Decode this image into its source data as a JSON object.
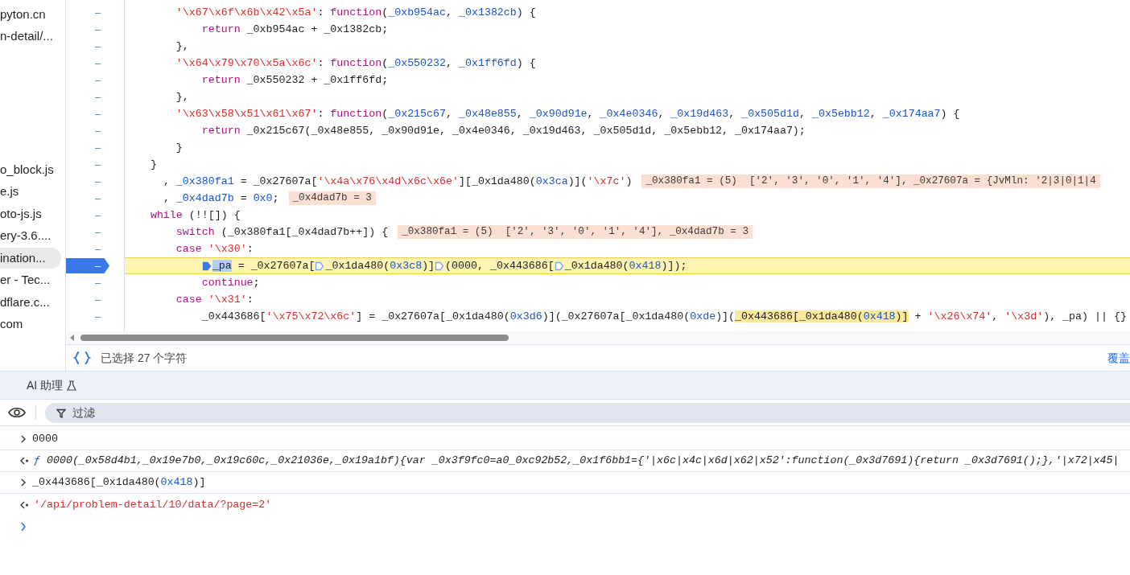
{
  "sidebar": {
    "upper_items": [
      {
        "label": "pyton.cn",
        "selected": false
      },
      {
        "label": "n-detail/...",
        "selected": false
      }
    ],
    "lower_items": [
      {
        "label": "o_block.js",
        "selected": false
      },
      {
        "label": "e.js",
        "selected": false
      },
      {
        "label": "oto-js.js",
        "selected": false
      },
      {
        "label": "ery-3.6....",
        "selected": false
      },
      {
        "label": "ination...",
        "selected": true
      },
      {
        "label": "er - Tec...",
        "selected": false
      },
      {
        "label": "dflare.c...",
        "selected": false
      },
      {
        "label": "com",
        "selected": false
      }
    ]
  },
  "code": {
    "lines": [
      {
        "gutter": "–",
        "paused": false,
        "segments": [
          {
            "kind": "indent8"
          },
          {
            "kind": "str",
            "text": "'\\x67\\x6f\\x6b\\x42\\x5a'"
          },
          {
            "kind": "plain",
            "text": ": "
          },
          {
            "kind": "kw",
            "text": "function"
          },
          {
            "kind": "plain",
            "text": "("
          },
          {
            "kind": "def",
            "text": "_0xb954ac"
          },
          {
            "kind": "plain",
            "text": ", "
          },
          {
            "kind": "def",
            "text": "_0x1382cb"
          },
          {
            "kind": "plain",
            "text": ") {"
          }
        ]
      },
      {
        "gutter": "–",
        "paused": false,
        "segments": [
          {
            "kind": "indent12"
          },
          {
            "kind": "kw",
            "text": "return"
          },
          {
            "kind": "plain",
            "text": " _0xb954ac + _0x1382cb;"
          }
        ]
      },
      {
        "gutter": "–",
        "paused": false,
        "segments": [
          {
            "kind": "indent8"
          },
          {
            "kind": "plain",
            "text": "},"
          }
        ]
      },
      {
        "gutter": "–",
        "paused": false,
        "segments": [
          {
            "kind": "indent8"
          },
          {
            "kind": "str",
            "text": "'\\x64\\x79\\x70\\x5a\\x6c'"
          },
          {
            "kind": "plain",
            "text": ": "
          },
          {
            "kind": "kw",
            "text": "function"
          },
          {
            "kind": "plain",
            "text": "("
          },
          {
            "kind": "def",
            "text": "_0x550232"
          },
          {
            "kind": "plain",
            "text": ", "
          },
          {
            "kind": "def",
            "text": "_0x1ff6fd"
          },
          {
            "kind": "plain",
            "text": ") {"
          }
        ]
      },
      {
        "gutter": "–",
        "paused": false,
        "segments": [
          {
            "kind": "indent12"
          },
          {
            "kind": "kw",
            "text": "return"
          },
          {
            "kind": "plain",
            "text": " _0x550232 + _0x1ff6fd;"
          }
        ]
      },
      {
        "gutter": "–",
        "paused": false,
        "segments": [
          {
            "kind": "indent8"
          },
          {
            "kind": "plain",
            "text": "},"
          }
        ]
      },
      {
        "gutter": "–",
        "paused": false,
        "segments": [
          {
            "kind": "indent8"
          },
          {
            "kind": "str",
            "text": "'\\x63\\x58\\x51\\x61\\x67'"
          },
          {
            "kind": "plain",
            "text": ": "
          },
          {
            "kind": "kw",
            "text": "function"
          },
          {
            "kind": "plain",
            "text": "("
          },
          {
            "kind": "def",
            "text": "_0x215c67"
          },
          {
            "kind": "plain",
            "text": ", "
          },
          {
            "kind": "def",
            "text": "_0x48e855"
          },
          {
            "kind": "plain",
            "text": ", "
          },
          {
            "kind": "def",
            "text": "_0x90d91e"
          },
          {
            "kind": "plain",
            "text": ", "
          },
          {
            "kind": "def",
            "text": "_0x4e0346"
          },
          {
            "kind": "plain",
            "text": ", "
          },
          {
            "kind": "def",
            "text": "_0x19d463"
          },
          {
            "kind": "plain",
            "text": ", "
          },
          {
            "kind": "def",
            "text": "_0x505d1d"
          },
          {
            "kind": "plain",
            "text": ", "
          },
          {
            "kind": "def",
            "text": "_0x5ebb12"
          },
          {
            "kind": "plain",
            "text": ", "
          },
          {
            "kind": "def",
            "text": "_0x174aa7"
          },
          {
            "kind": "plain",
            "text": ") {"
          }
        ]
      },
      {
        "gutter": "–",
        "paused": false,
        "segments": [
          {
            "kind": "indent12"
          },
          {
            "kind": "kw",
            "text": "return"
          },
          {
            "kind": "plain",
            "text": " _0x215c67(_0x48e855, _0x90d91e, _0x4e0346, _0x19d463, _0x505d1d, _0x5ebb12, _0x174aa7);"
          }
        ]
      },
      {
        "gutter": "–",
        "paused": false,
        "segments": [
          {
            "kind": "indent8"
          },
          {
            "kind": "plain",
            "text": "}"
          }
        ]
      },
      {
        "gutter": "–",
        "paused": false,
        "segments": [
          {
            "kind": "indent4"
          },
          {
            "kind": "plain",
            "text": "}"
          }
        ]
      },
      {
        "gutter": "–",
        "paused": false,
        "segments": [
          {
            "kind": "indent6"
          },
          {
            "kind": "plain",
            "text": ", "
          },
          {
            "kind": "def",
            "text": "_0x380fa1"
          },
          {
            "kind": "plain",
            "text": " = _0x27607a["
          },
          {
            "kind": "str",
            "text": "'\\x4a\\x76\\x4d\\x6c\\x6e'"
          },
          {
            "kind": "plain",
            "text": "][_0x1da480("
          },
          {
            "kind": "num",
            "text": "0x3ca"
          },
          {
            "kind": "plain",
            "text": ")]("
          },
          {
            "kind": "str",
            "text": "'\\x7c'"
          },
          {
            "kind": "plain",
            "text": ")"
          },
          {
            "kind": "note",
            "text": "_0x380fa1 = (5)  ['2', '3', '0', '1', '4'], _0x27607a = {JvMln: '2|3|0|1|4"
          }
        ]
      },
      {
        "gutter": "–",
        "paused": false,
        "segments": [
          {
            "kind": "indent6"
          },
          {
            "kind": "plain",
            "text": ", "
          },
          {
            "kind": "def",
            "text": "_0x4dad7b"
          },
          {
            "kind": "plain",
            "text": " = "
          },
          {
            "kind": "num",
            "text": "0x0"
          },
          {
            "kind": "plain",
            "text": ";"
          },
          {
            "kind": "note",
            "text": "_0x4dad7b = 3"
          }
        ]
      },
      {
        "gutter": "–",
        "paused": false,
        "segments": [
          {
            "kind": "indent4"
          },
          {
            "kind": "kw",
            "text": "while"
          },
          {
            "kind": "plain",
            "text": " (!![]) {"
          }
        ]
      },
      {
        "gutter": "–",
        "paused": false,
        "segments": [
          {
            "kind": "indent8"
          },
          {
            "kind": "kw",
            "text": "switch"
          },
          {
            "kind": "plain",
            "text": " (_0x380fa1[_0x4dad7b++]) {"
          },
          {
            "kind": "note",
            "text": "_0x380fa1 = (5)  ['2', '3', '0', '1', '4'], _0x4dad7b = 3"
          }
        ]
      },
      {
        "gutter": "–",
        "paused": false,
        "segments": [
          {
            "kind": "indent8"
          },
          {
            "kind": "kw",
            "text": "case "
          },
          {
            "kind": "str",
            "text": "'\\x30'"
          },
          {
            "kind": "plain",
            "text": ":"
          }
        ]
      },
      {
        "gutter": "–",
        "paused": true,
        "segments": [
          {
            "kind": "indent12"
          },
          {
            "kind": "marker",
            "active": true
          },
          {
            "kind": "sel",
            "text": "_pa"
          },
          {
            "kind": "plain",
            "text": " = _0x27607a["
          },
          {
            "kind": "marker",
            "active": false
          },
          {
            "kind": "plain",
            "text": "_0x1da480("
          },
          {
            "kind": "num",
            "text": "0x3c8"
          },
          {
            "kind": "plain",
            "text": ")]"
          },
          {
            "kind": "marker",
            "active": false
          },
          {
            "kind": "plain",
            "text": "(0000, _0x443686["
          },
          {
            "kind": "marker",
            "active": false
          },
          {
            "kind": "plain",
            "text": "_0x1da480("
          },
          {
            "kind": "num",
            "text": "0x418"
          },
          {
            "kind": "plain",
            "text": ")]);"
          }
        ]
      },
      {
        "gutter": "–",
        "paused": false,
        "segments": [
          {
            "kind": "indent12"
          },
          {
            "kind": "kw",
            "text": "continue"
          },
          {
            "kind": "plain",
            "text": ";"
          }
        ]
      },
      {
        "gutter": "–",
        "paused": false,
        "segments": [
          {
            "kind": "indent8"
          },
          {
            "kind": "kw",
            "text": "case "
          },
          {
            "kind": "str",
            "text": "'\\x31'"
          },
          {
            "kind": "plain",
            "text": ":"
          }
        ]
      },
      {
        "gutter": "–",
        "paused": false,
        "segments": [
          {
            "kind": "indent12"
          },
          {
            "kind": "plain",
            "text": "_0x443686["
          },
          {
            "kind": "str",
            "text": "'\\x75\\x72\\x6c'"
          },
          {
            "kind": "plain",
            "text": "] = _0x27607a[_0x1da480("
          },
          {
            "kind": "num",
            "text": "0x3d6"
          },
          {
            "kind": "plain",
            "text": ")](_0x27607a[_0x1da480("
          },
          {
            "kind": "num",
            "text": "0xde"
          },
          {
            "kind": "plain",
            "text": ")]("
          },
          {
            "kind": "hl",
            "text": "_0x443686[_0x1da480("
          },
          {
            "kind": "hlnum",
            "text": "0x418"
          },
          {
            "kind": "hl",
            "text": ")]"
          },
          {
            "kind": "plain",
            "text": " + "
          },
          {
            "kind": "str",
            "text": "'\\x26\\x74'"
          },
          {
            "kind": "plain",
            "text": ", "
          },
          {
            "kind": "str",
            "text": "'\\x3d'"
          },
          {
            "kind": "plain",
            "text": "), _pa) || {}"
          }
        ]
      }
    ]
  },
  "status_bar": {
    "selection": "已选择 27 个字符",
    "coverage": "覆盖"
  },
  "drawer": {
    "tab": "AI 助理"
  },
  "console": {
    "filter": {
      "placeholder": "过滤"
    },
    "rows": [
      {
        "kind": "input",
        "segments": [
          {
            "kind": "plain",
            "text": "0000"
          }
        ]
      },
      {
        "kind": "output",
        "segments": [
          {
            "kind": "fn",
            "text": "ƒ"
          },
          {
            "kind": "italic",
            "text": " 0000(_0x58d4b1,_0x19e7b0,_0x19c60c,_0x21036e,_0x19a1bf){var _0x3f9fc0=a0_0xc92b52,_0x1f6bb1={'|x6c|x4c|x6d|x62|x52':function(_0x3d7691){return _0x3d7691();},'|x72|x45|"
          }
        ]
      },
      {
        "kind": "input",
        "segments": [
          {
            "kind": "plain",
            "text": "_0x443686[_0x1da480("
          },
          {
            "kind": "num",
            "text": "0x418"
          },
          {
            "kind": "plain",
            "text": ")]"
          }
        ]
      },
      {
        "kind": "output",
        "segments": [
          {
            "kind": "res",
            "text": "'/api/problem-detail/10/data/?page=2'"
          }
        ]
      },
      {
        "kind": "prompt",
        "segments": []
      }
    ]
  }
}
